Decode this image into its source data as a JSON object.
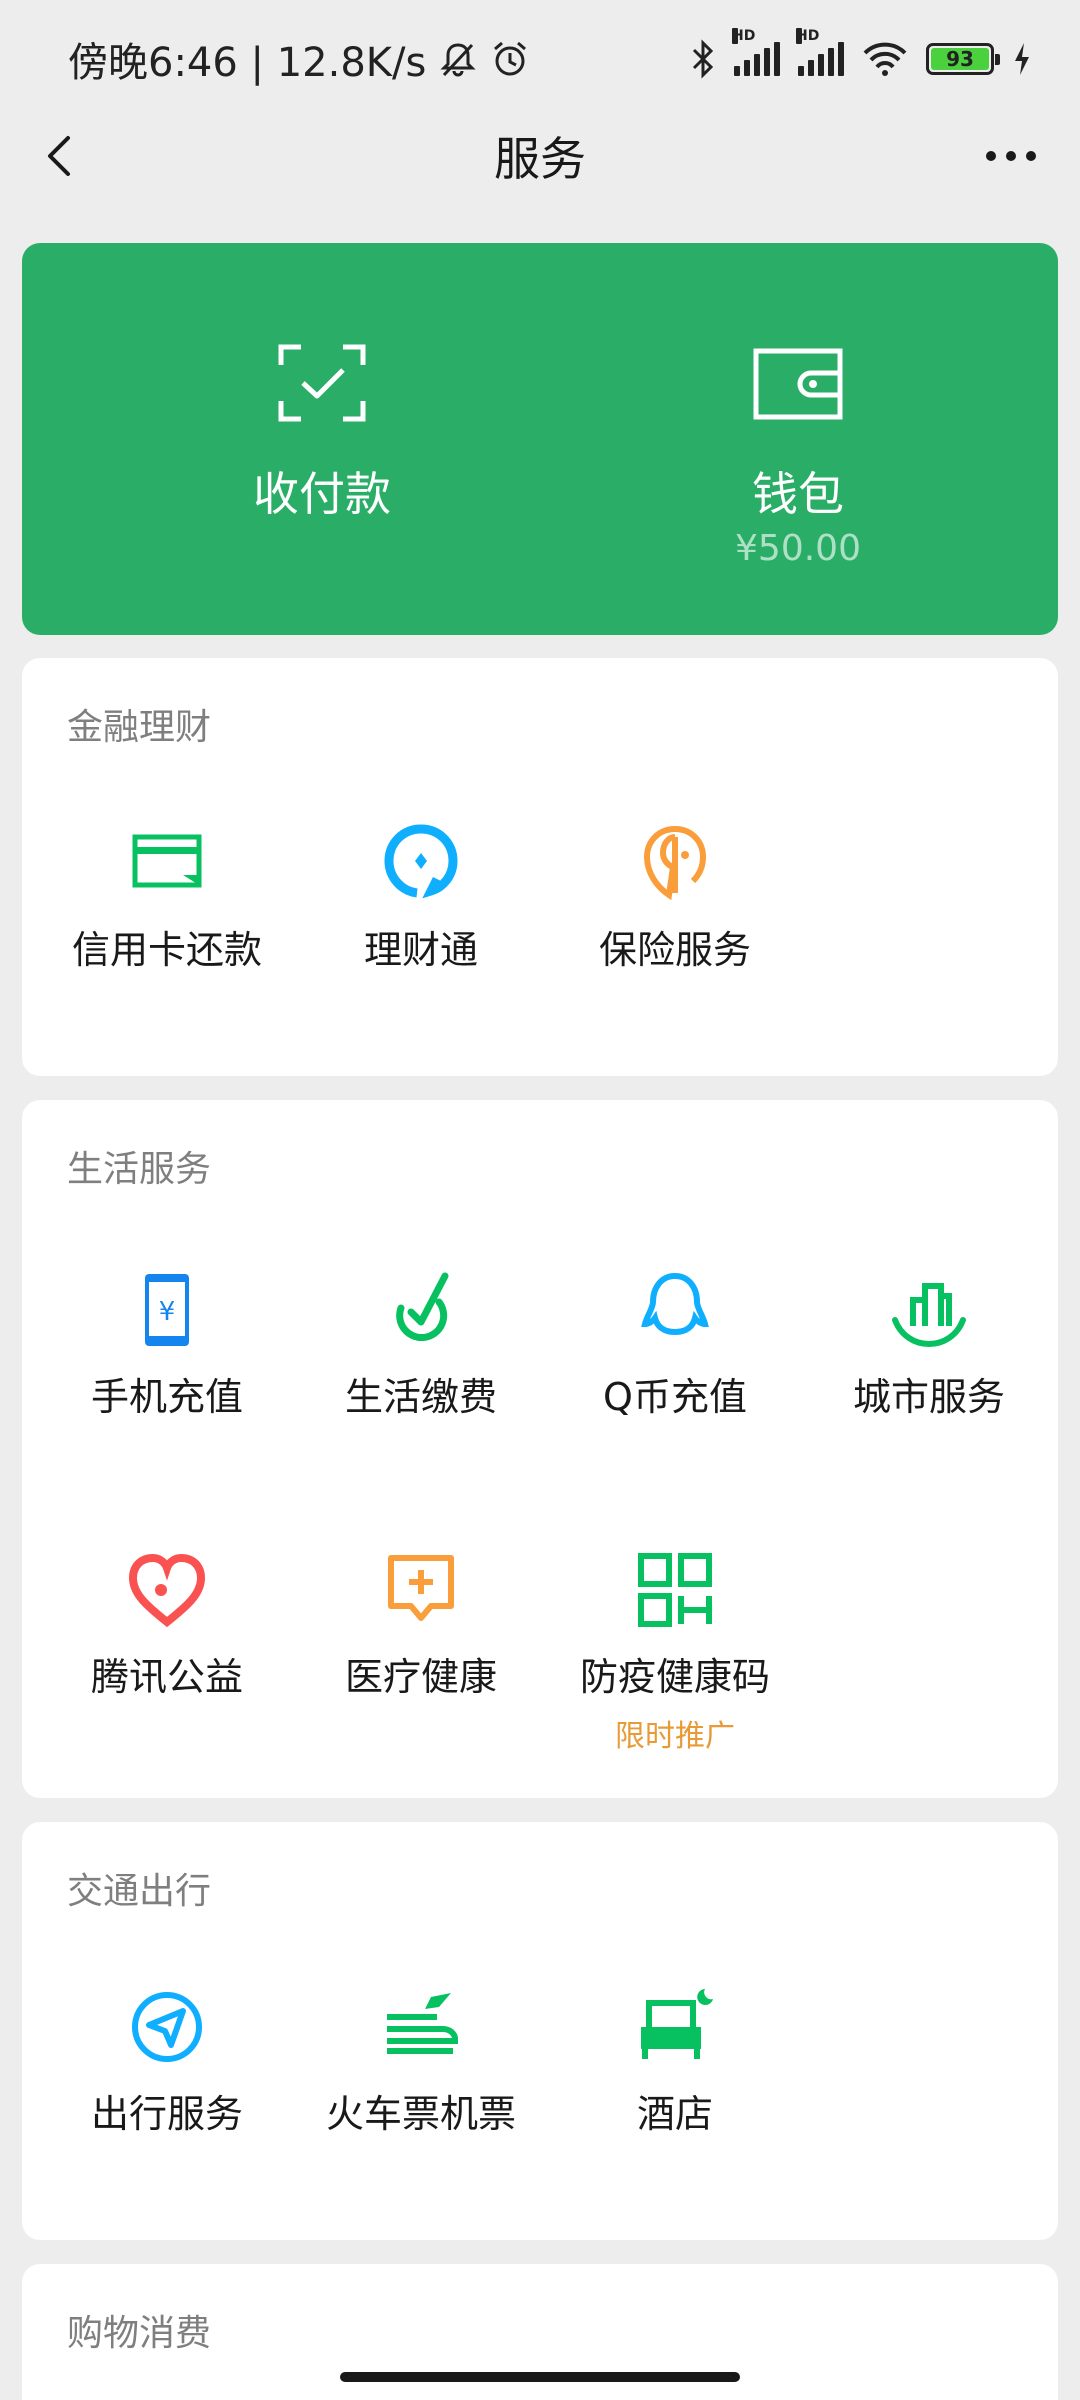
{
  "status_bar": {
    "time_text": "傍晚6:46 | 12.8K/s",
    "battery_level": "93",
    "signal_hd_1": "HD",
    "signal_hd_2": "HD"
  },
  "nav": {
    "title": "服务"
  },
  "pay_card": {
    "pay_label": "收付款",
    "wallet_label": "钱包",
    "wallet_balance": "¥50.00",
    "background": "#2aae67"
  },
  "sections": {
    "finance": {
      "title": "金融理财",
      "items": [
        {
          "label": "信用卡还款",
          "icon": "credit-card-icon"
        },
        {
          "label": "理财通",
          "icon": "wealth-icon"
        },
        {
          "label": "保险服务",
          "icon": "insurance-icon"
        }
      ]
    },
    "life": {
      "title": "生活服务",
      "items": [
        {
          "label": "手机充值",
          "icon": "phone-topup-icon"
        },
        {
          "label": "生活缴费",
          "icon": "utility-payment-icon"
        },
        {
          "label": "Q币充值",
          "icon": "qq-coin-icon"
        },
        {
          "label": "城市服务",
          "icon": "city-service-icon"
        },
        {
          "label": "腾讯公益",
          "icon": "charity-icon"
        },
        {
          "label": "医疗健康",
          "icon": "medical-icon"
        },
        {
          "label": "防疫健康码",
          "icon": "health-code-icon",
          "tag": "限时推广"
        }
      ]
    },
    "transport": {
      "title": "交通出行",
      "items": [
        {
          "label": "出行服务",
          "icon": "travel-icon"
        },
        {
          "label": "火车票机票",
          "icon": "train-flight-icon"
        },
        {
          "label": "酒店",
          "icon": "hotel-icon"
        }
      ]
    },
    "shopping": {
      "title": "购物消费"
    }
  },
  "colors": {
    "green": "#07c160",
    "blue": "#10aeff",
    "orange": "#fa9d3b",
    "red": "#fa5151",
    "phone_blue": "#1485ee",
    "tag_orange": "#e89a35"
  }
}
